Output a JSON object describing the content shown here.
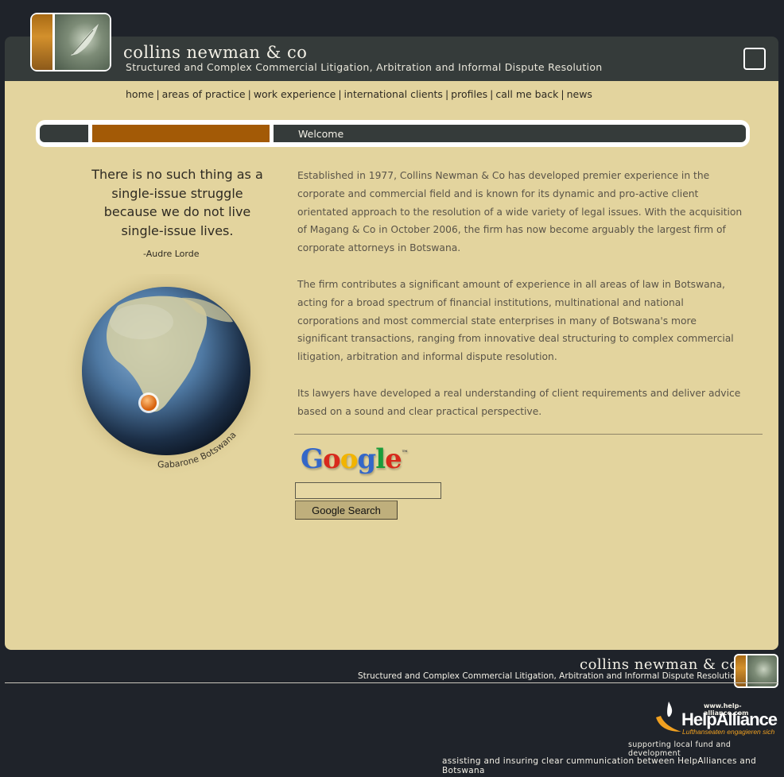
{
  "header": {
    "brand": "collins newman & co",
    "tagline": "Structured and Complex Commercial Litigation, Arbitration and Informal Dispute Resolution"
  },
  "nav": {
    "items": [
      {
        "label": "home"
      },
      {
        "label": "areas of practice"
      },
      {
        "label": "work experience"
      },
      {
        "label": "international clients"
      },
      {
        "label": "profiles"
      },
      {
        "label": "call me back"
      },
      {
        "label": "news"
      }
    ],
    "separator": "|"
  },
  "section": {
    "title": "Welcome"
  },
  "quote": {
    "text": "There is no such thing as a single-issue struggle because we do not live single-issue lives.",
    "author": "-Audre Lorde"
  },
  "globe": {
    "caption": "Gabarone Botswana"
  },
  "content": {
    "paragraphs": [
      "Established in 1977, Collins Newman & Co has developed premier experience in the corporate and commercial field and is known for its dynamic and pro-active client orientated approach to the resolution of a wide variety of legal issues.  With the acquisition of Magang & Co in October 2006, the firm has now become arguably the largest firm of corporate attorneys in Botswana.",
      "The firm contributes a significant amount of experience in all areas of law in Botswana, acting for a broad spectrum of financial institutions, multinational and national corporations and most commercial state enterprises in many of Botswana's more significant transactions, ranging from innovative deal structuring to complex commercial litigation, arbitration and informal dispute resolution.",
      "Its lawyers have developed a real understanding of client requirements and deliver advice based on a sound and clear practical perspective."
    ]
  },
  "search": {
    "logo": "Google",
    "tm": "™",
    "input_value": "",
    "button_label": "Google Search",
    "colors": [
      "#3467c8",
      "#d8291c",
      "#f2b400",
      "#3467c8",
      "#1a9c3a",
      "#d8291c"
    ]
  },
  "footer": {
    "brand": "collins newman & co",
    "tagline": "Structured and Complex Commercial Litigation, Arbitration and Informal Dispute Resolution",
    "helpalliance": {
      "url": "www.help-alliance.com",
      "name": "HelpAlliance",
      "sub": "Lufthanseaten engagieren sich",
      "line1": "supporting local fund and development",
      "line2": "assisting and insuring clear cummunication between HelpAlliances and Botswana"
    }
  },
  "colors": {
    "background": "#1f232a",
    "panel": "#e3d49e",
    "bar": "#353b3a",
    "accent": "#a35a06"
  }
}
